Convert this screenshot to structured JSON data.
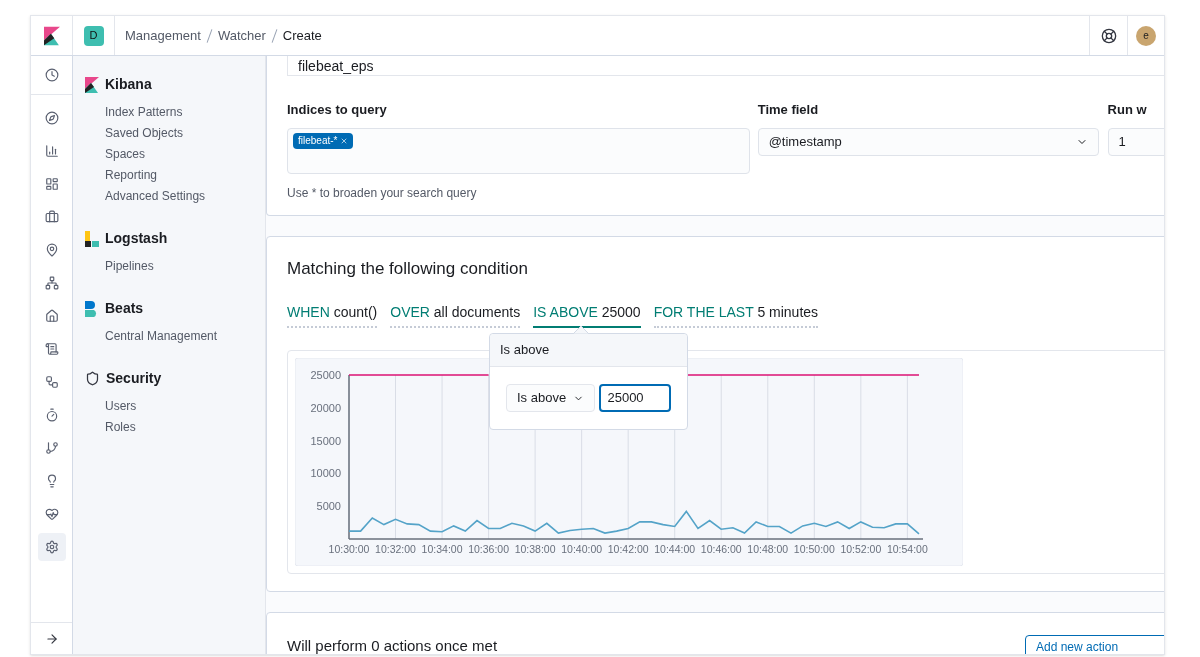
{
  "header": {
    "space_badge": "D",
    "breadcrumbs": [
      "Management",
      "Watcher",
      "Create"
    ],
    "avatar": "e"
  },
  "nav_rail": {
    "items": [
      {
        "selected": false
      },
      {
        "selected": false
      },
      {
        "selected": false
      },
      {
        "selected": false
      },
      {
        "selected": false
      },
      {
        "selected": false
      },
      {
        "selected": false
      },
      {
        "selected": false
      },
      {
        "selected": false
      },
      {
        "selected": false
      },
      {
        "selected": false
      },
      {
        "selected": false
      },
      {
        "selected": false
      },
      {
        "selected": false
      },
      {
        "selected": true
      }
    ]
  },
  "sidebar": {
    "sections": [
      {
        "kind": "kibana",
        "title": "Kibana",
        "items": [
          "Index Patterns",
          "Saved Objects",
          "Spaces",
          "Reporting",
          "Advanced Settings"
        ]
      },
      {
        "kind": "logstash",
        "title": "Logstash",
        "items": [
          "Pipelines"
        ]
      },
      {
        "kind": "beats",
        "title": "Beats",
        "items": [
          "Central Management"
        ]
      },
      {
        "kind": "security",
        "title": "Security",
        "items": [
          "Users",
          "Roles"
        ]
      }
    ]
  },
  "settings_card": {
    "name_value": "filebeat_eps",
    "indices_label": "Indices to query",
    "indices_tags": [
      "filebeat-*"
    ],
    "indices_help": "Use * to broaden your search query",
    "time_field_label": "Time field",
    "time_field_value": "@timestamp",
    "run_label": "Run w",
    "run_value": "1"
  },
  "condition_card": {
    "title": "Matching the following condition",
    "clauses": [
      {
        "keyword": "WHEN",
        "value": "count()",
        "selected": false
      },
      {
        "keyword": "OVER",
        "value": "all documents",
        "selected": false
      },
      {
        "keyword": "IS ABOVE",
        "value": "25000",
        "selected": true
      },
      {
        "keyword": "FOR THE LAST",
        "value": "5 minutes",
        "selected": false
      }
    ],
    "popover": {
      "title": "Is above",
      "select_value": "Is above",
      "input_value": "25000"
    },
    "chart_data": {
      "type": "line",
      "categories": [
        "10:30:00",
        null,
        null,
        null,
        "10:32:00",
        null,
        null,
        null,
        "10:34:00",
        null,
        null,
        null,
        "10:36:00",
        null,
        null,
        null,
        "10:38:00",
        null,
        null,
        null,
        "10:40:00",
        null,
        null,
        null,
        "10:42:00",
        null,
        null,
        null,
        "10:44:00",
        null,
        null,
        null,
        "10:46:00",
        null,
        null,
        null,
        "10:48:00",
        null,
        null,
        null,
        "10:50:00",
        null,
        null,
        null,
        "10:52:00",
        null,
        null,
        null,
        "10:54:00",
        null
      ],
      "yticks": [
        5000,
        10000,
        15000,
        20000,
        25000
      ],
      "ylim": [
        0,
        25000
      ],
      "series": [
        {
          "color": "#54a3c8",
          "values": [
            1200,
            1200,
            3200,
            2200,
            3000,
            2300,
            2200,
            1200,
            1100,
            2000,
            1200,
            2800,
            1600,
            1600,
            2400,
            2000,
            1200,
            2400,
            900,
            1300,
            1500,
            1600,
            900,
            1200,
            1600,
            2600,
            2600,
            2200,
            1900,
            4200,
            1600,
            2800,
            1500,
            1700,
            900,
            2600,
            1900,
            1900,
            900,
            2000,
            2400,
            1900,
            2600,
            1600,
            2600,
            1800,
            1700,
            2300,
            2300,
            800
          ]
        },
        {
          "color": "#db1374",
          "values": [
            25000,
            25000,
            25000,
            25000,
            25000,
            25000,
            25000,
            25000,
            25000,
            25000,
            25000,
            25000,
            25000,
            null,
            null,
            null,
            null,
            null,
            null,
            null,
            null,
            null,
            null,
            null,
            null,
            null,
            null,
            null,
            null,
            25000,
            25000,
            25000,
            25000,
            25000,
            25000,
            25000,
            25000,
            25000,
            25000,
            25000,
            25000,
            25000,
            25000,
            25000,
            25000,
            25000,
            25000,
            25000,
            25000,
            25000
          ]
        }
      ],
      "grid": true
    }
  },
  "actions_card": {
    "title": "Will perform 0 actions once met",
    "button": "Add new action"
  }
}
